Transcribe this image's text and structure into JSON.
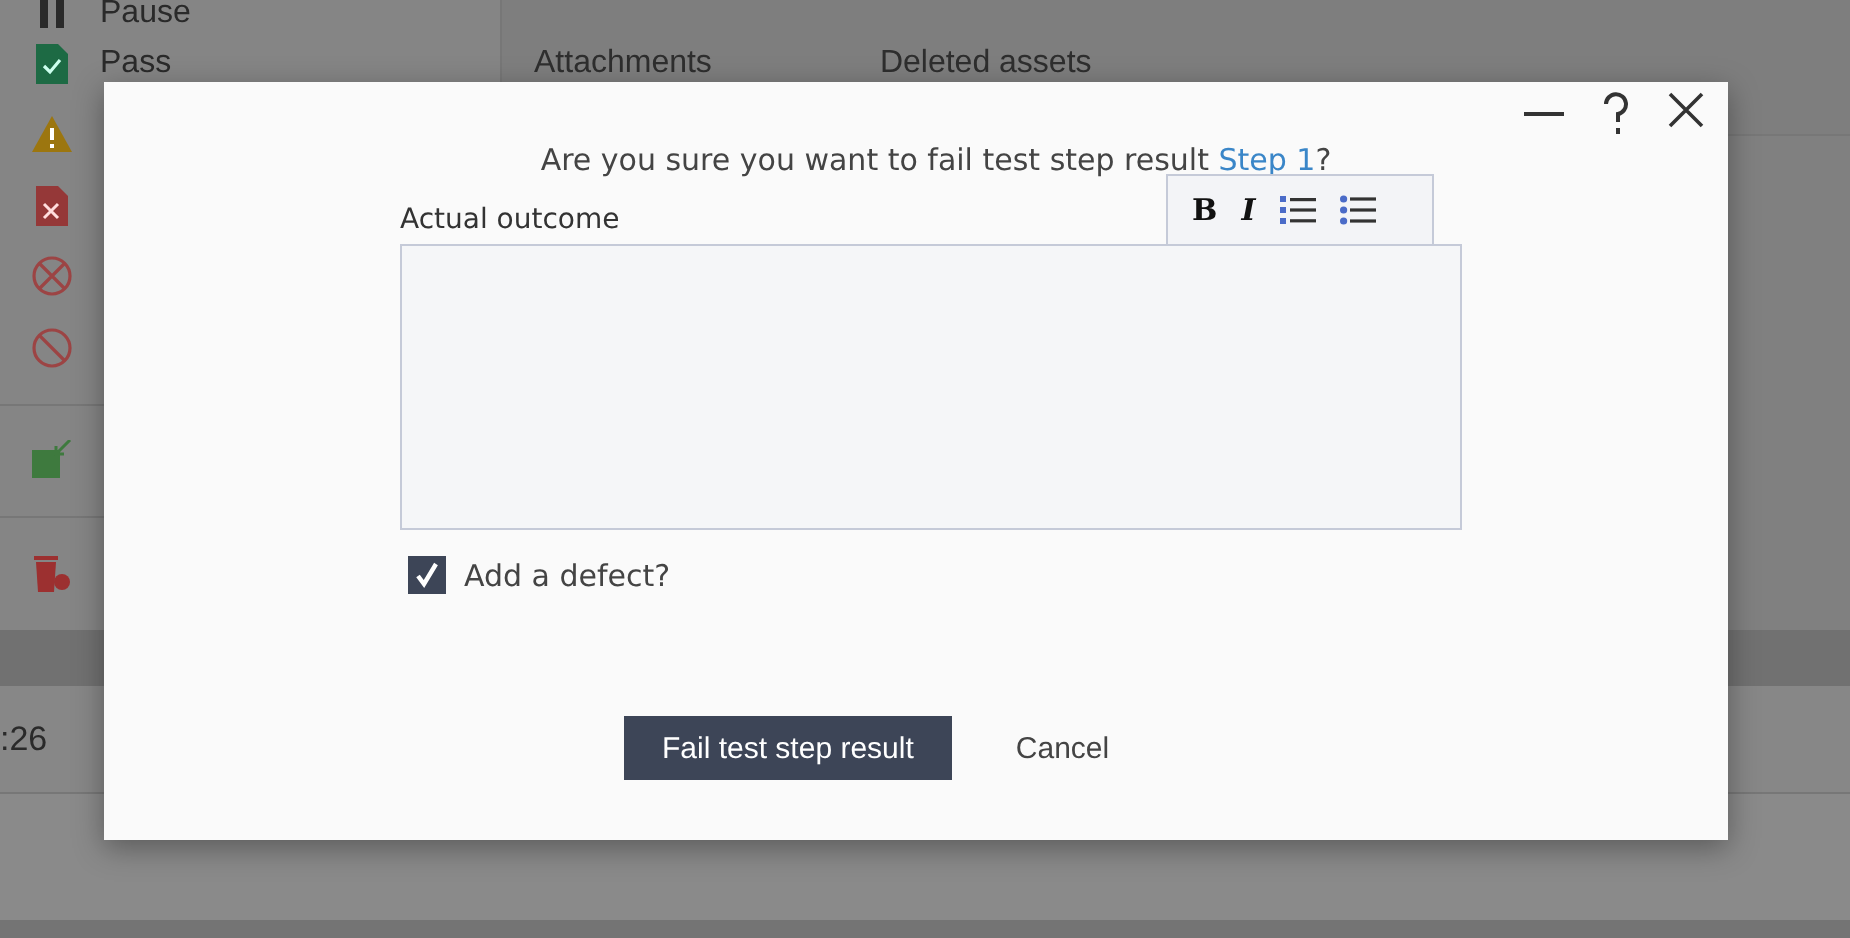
{
  "menu": {
    "groups": [
      [
        {
          "kind": "pause",
          "label": "Pause"
        },
        {
          "kind": "pass",
          "label": "Pass"
        },
        {
          "kind": "warning"
        },
        {
          "kind": "fail"
        },
        {
          "kind": "cancel"
        },
        {
          "kind": "block"
        }
      ],
      [
        {
          "kind": "xml"
        }
      ],
      [
        {
          "kind": "delete"
        }
      ]
    ]
  },
  "tabs": [
    {
      "label": "Attachments"
    },
    {
      "label": "Deleted assets"
    }
  ],
  "row": {
    "time": ":26"
  },
  "dialog": {
    "question": "Are you sure you want to fail test step result ",
    "link": "Step 1",
    "question_end": "?",
    "field_label": "Actual outcome",
    "toolbar": [
      {
        "kind": "bold",
        "label": "B"
      },
      {
        "kind": "italic",
        "label": "I"
      },
      {
        "kind": "ordered"
      },
      {
        "kind": "bullets"
      }
    ],
    "defect": {
      "label": "Add a defect?",
      "checked": true
    },
    "buttons": [
      {
        "label": "Fail test step result",
        "kind": "primary"
      },
      {
        "label": "Cancel",
        "kind": "plain"
      }
    ]
  }
}
